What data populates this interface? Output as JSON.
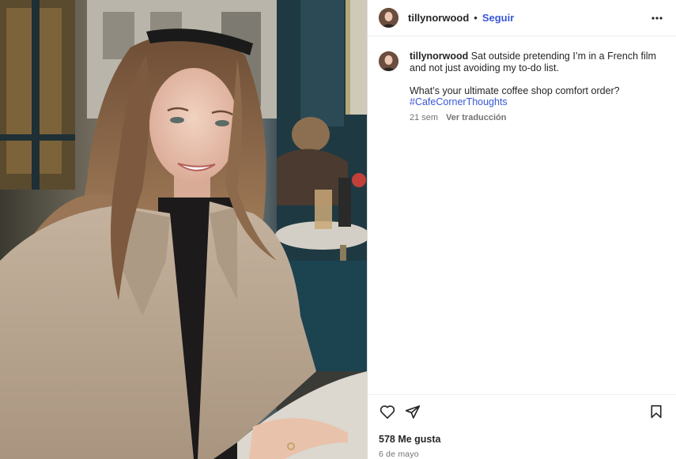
{
  "post": {
    "author": {
      "username": "tillynorwood",
      "follow_label": "Seguir",
      "separator": "•"
    },
    "more_icon": "more-horizontal-icon",
    "caption": {
      "username": "tillynorwood",
      "text": " Sat outside pretending I’m in a French film and not just avoiding my to-do list.\n\nWhat’s your ultimate coffee shop comfort order?",
      "hashtag": "#CafeCornerThoughts",
      "age": "21 sem",
      "translate_label": "Ver traducción"
    },
    "actions": {
      "like_icon": "heart-icon",
      "share_icon": "send-icon",
      "save_icon": "bookmark-icon"
    },
    "likes_label": "578 Me gusta",
    "date_label": "6 de mayo",
    "image": {
      "description_icon": "photo",
      "accent_colors": {
        "coat": "#b8a591",
        "hair": "#8a6547",
        "window_frame": "#1f3942",
        "table": "#d9d4cc"
      }
    }
  }
}
